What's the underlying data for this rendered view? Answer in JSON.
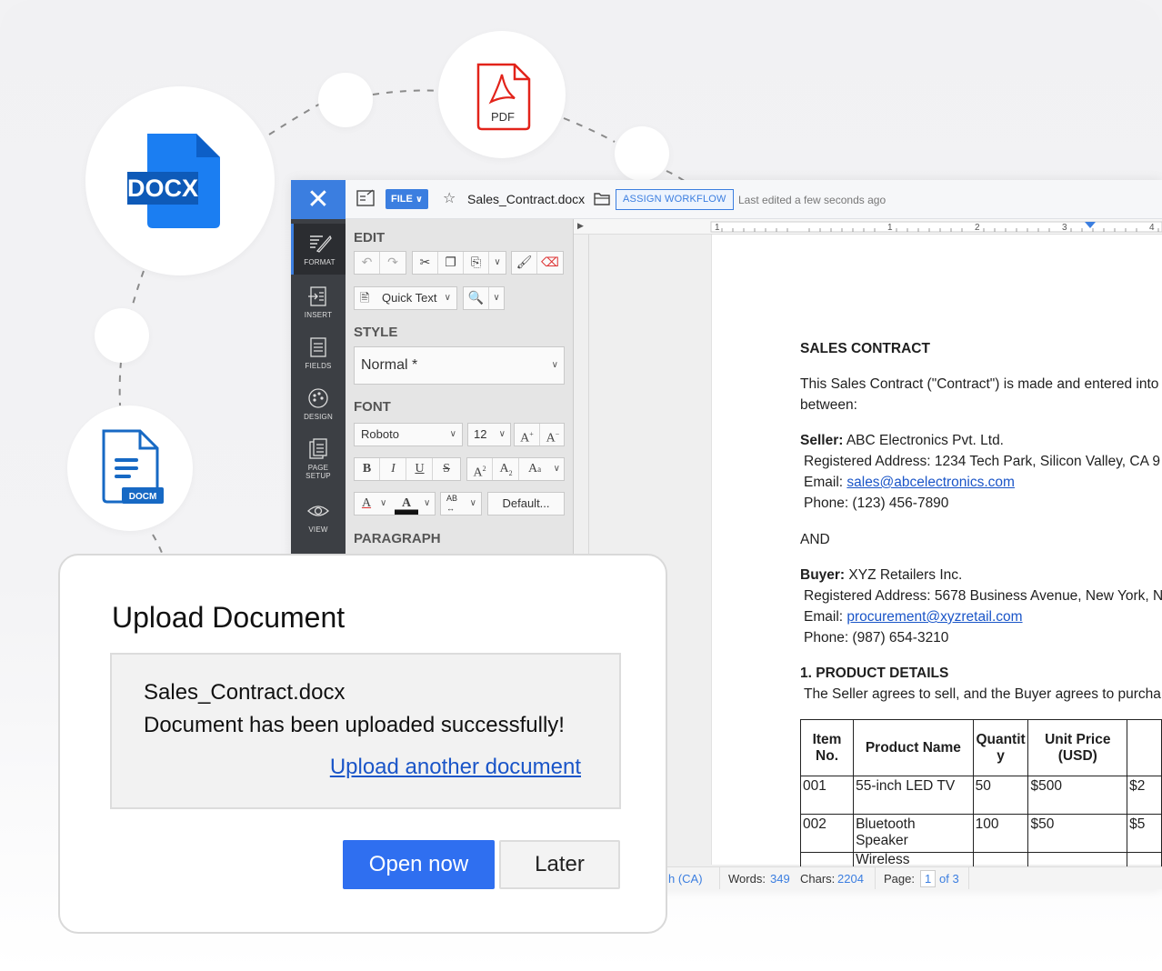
{
  "file_icons": {
    "docx_label": "DOCX",
    "pdf_label": "PDF",
    "docm_label": "DOCM"
  },
  "editor": {
    "toolbar": {
      "close_icon": "close-icon",
      "file_label": "FILE",
      "doc_name": "Sales_Contract.docx",
      "assign_label": "ASSIGN WORKFLOW",
      "last_edited": "Last edited a few seconds ago"
    },
    "left_nav": [
      {
        "label": "FORMAT",
        "icon": "format-icon"
      },
      {
        "label": "INSERT",
        "icon": "insert-icon"
      },
      {
        "label": "FIELDS",
        "icon": "fields-icon"
      },
      {
        "label": "DESIGN",
        "icon": "design-icon"
      },
      {
        "label1": "PAGE",
        "label2": "SETUP",
        "icon": "page-setup-icon"
      },
      {
        "label": "VIEW",
        "icon": "view-icon"
      }
    ],
    "panel": {
      "edit_title": "EDIT",
      "quick_text": "Quick Text",
      "style_title": "STYLE",
      "style_value": "Normal *",
      "font_title": "FONT",
      "font_value": "Roboto",
      "font_size": "12",
      "default_label": "Default...",
      "paragraph_title": "PARAGRAPH"
    },
    "ruler": [
      "1",
      "1",
      "2",
      "3",
      "4"
    ],
    "document": {
      "heading": "SALES CONTRACT",
      "intro_1": "This Sales Contract (\"Contract\") is made and entered into",
      "intro_2": "between:",
      "seller_label": "Seller:",
      "seller_name": " ABC Electronics Pvt. Ltd.",
      "seller_address": "Registered Address: 1234 Tech Park, Silicon Valley, CA 9",
      "seller_email_label": "Email: ",
      "seller_email": "sales@abcelectronics.com",
      "seller_phone": "Phone: (123) 456-7890",
      "and": "AND",
      "buyer_label": "Buyer:",
      "buyer_name": " XYZ Retailers Inc.",
      "buyer_address": "Registered Address: 5678 Business Avenue, New York, N",
      "buyer_email_label": "Email: ",
      "buyer_email": "procurement@xyzretail.com",
      "buyer_phone": "Phone: (987) 654-3210",
      "section_1": "1. PRODUCT DETAILS",
      "section_1_text": "The Seller agrees to sell, and the Buyer agrees to purcha",
      "table": {
        "headers": {
          "item_a": "Item",
          "item_b": "No.",
          "product": "Product Name",
          "qty_a": "Quantit",
          "qty_b": "y",
          "price_a": "Unit Price",
          "price_b": "(USD)"
        },
        "rows": [
          {
            "no": "001",
            "name": "55-inch LED TV",
            "qty": "50",
            "price": "$500",
            "total": "$2"
          },
          {
            "no": "002",
            "name": "Bluetooth Speaker",
            "qty": "100",
            "price": "$50",
            "total": "$5"
          },
          {
            "no": "",
            "name": "Wireless",
            "qty": "",
            "price": "",
            "total": ""
          }
        ]
      }
    },
    "status": {
      "lang": "h (CA)",
      "words_label": "Words:",
      "words": "349",
      "chars_label": "Chars:",
      "chars": "2204",
      "page_label": "Page:",
      "page": "1",
      "page_of": "of 3"
    }
  },
  "dialog": {
    "title": "Upload Document",
    "file_name": "Sales_Contract.docx",
    "message": "Document has been uploaded successfully!",
    "upload_another": "Upload another document",
    "open_now": "Open now",
    "later": "Later"
  },
  "colors": {
    "accent": "#3b7ee0",
    "docx_blue": "#1b7ef2",
    "pdf_red": "#e2231a",
    "docm_blue": "#1769c4",
    "primary_button": "#2f6ff0"
  }
}
